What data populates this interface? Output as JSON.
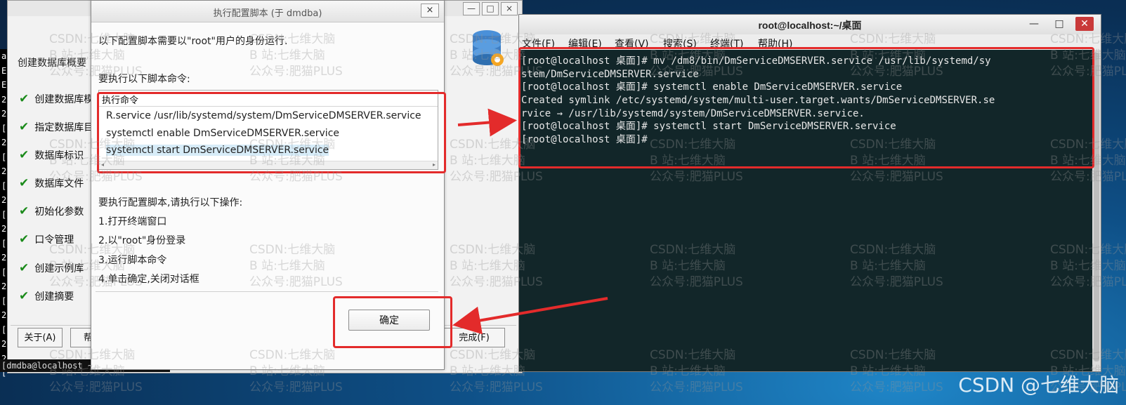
{
  "background_installer": {
    "left_margin_chars": [
      "a",
      "E",
      "E",
      "2",
      "2",
      "[",
      "2",
      "[",
      "2",
      "[",
      "2",
      "[",
      "2",
      "[",
      "2",
      "[",
      "2",
      "[",
      "2",
      "[",
      "2",
      "2",
      "["
    ],
    "heading": "创建数据库概要",
    "steps": [
      {
        "label": "创建数据库模"
      },
      {
        "label": "指定数据库目"
      },
      {
        "label": "数据库标识"
      },
      {
        "label": "数据库文件"
      },
      {
        "label": "初始化参数"
      },
      {
        "label": "口令管理"
      },
      {
        "label": "创建示例库"
      },
      {
        "label": "创建摘要"
      }
    ],
    "about_button": "关于(A)",
    "help_button": "帮助",
    "finish_button": "完成(F)",
    "bottom_prompt": "[dmdba@localhost ~]$"
  },
  "dialog": {
    "title": "执行配置脚本 (于 dmdba)",
    "close_glyph": "×",
    "intro": "以下配置脚本需要以\"root\"用户的身份运行.",
    "commands_label": "要执行以下脚本命令:",
    "table_header": "执行命令",
    "commands": [
      "R.service /usr/lib/systemd/system/DmServiceDMSERVER.service",
      "systemctl enable DmServiceDMSERVER.service",
      "systemctl start DmServiceDMSERVER.service"
    ],
    "instructions_title": "要执行配置脚本,请执行以下操作:",
    "instructions": [
      "1.打开终端窗口",
      "2.以\"root\"身份登录",
      "3.运行脚本命令",
      "4.单击确定,关闭对话框"
    ],
    "ok_button": "确定"
  },
  "terminal": {
    "title": "root@localhost:~/桌面",
    "menu": [
      "文件(F)",
      "编辑(E)",
      "查看(V)",
      "搜索(S)",
      "终端(T)",
      "帮助(H)"
    ],
    "lines": [
      "[root@localhost 桌面]# mv /dm8/bin/DmServiceDMSERVER.service /usr/lib/systemd/sy",
      "stem/DmServiceDMSERVER.service",
      "[root@localhost 桌面]# systemctl enable DmServiceDMSERVER.service",
      "Created symlink /etc/systemd/system/multi-user.target.wants/DmServiceDMSERVER.se",
      "rvice → /usr/lib/systemd/system/DmServiceDMSERVER.service.",
      "[root@localhost 桌面]# systemctl start DmServiceDMSERVER.service",
      "[root@localhost 桌面]# "
    ]
  },
  "watermark": {
    "line1": "CSDN:七维大脑",
    "line2": "B 站:七维大脑",
    "line3": "公众号:肥猫PLUS"
  },
  "brand": "CSDN @七维大脑",
  "colors": {
    "highlight_red": "#e32b2b",
    "terminal_bg": "#122629",
    "check_green": "#1a8a1a"
  }
}
